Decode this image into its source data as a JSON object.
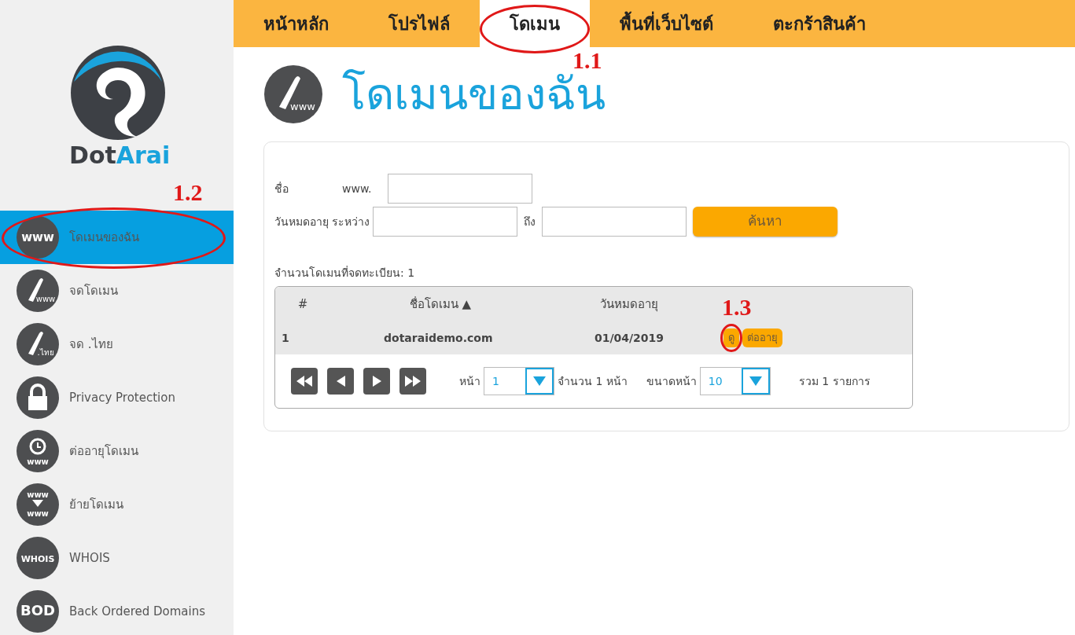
{
  "nav": [
    {
      "label": "หน้าหลัก",
      "selected": false
    },
    {
      "label": "โปรไฟล์",
      "selected": false
    },
    {
      "label": "โดเมน",
      "selected": true,
      "callout": "1.1"
    },
    {
      "label": "พื้นที่เว็บไซต์",
      "selected": false
    },
    {
      "label": "ตะกร้าสินค้า",
      "selected": false
    }
  ],
  "logo": {
    "parts": [
      "Dot",
      "Arai"
    ]
  },
  "sidebar": {
    "items": [
      {
        "label": "โดเมนของฉัน",
        "kind": "text",
        "icon_texts": [
          "www"
        ],
        "selected": true,
        "callout": "1.2"
      },
      {
        "label": "จดโดเมน",
        "kind": "pen",
        "icon_texts": [
          "www"
        ],
        "selected": false
      },
      {
        "label": "จด .ไทย",
        "kind": "pen",
        "icon_texts": [
          ".ไทย"
        ],
        "selected": false
      },
      {
        "label": "Privacy Protection",
        "kind": "lock",
        "selected": false
      },
      {
        "label": "ต่ออายุโดเมน",
        "kind": "clock",
        "icon_texts": [
          "www"
        ],
        "selected": false
      },
      {
        "label": "ย้ายโดเมน",
        "kind": "transfer",
        "icon_texts": [
          "www",
          "www"
        ],
        "selected": false
      },
      {
        "label": "WHOIS",
        "kind": "text",
        "icon_texts": [
          "WHOIS"
        ],
        "selected": false
      },
      {
        "label": "Back Ordered Domains",
        "kind": "text",
        "icon_texts": [
          "BOD"
        ],
        "selected": false
      }
    ]
  },
  "page_title": {
    "text": "โดเมนของฉัน",
    "icon_text": "www"
  },
  "search": {
    "name_label": "ชื่อ",
    "prefix": "www.",
    "date_label": "วันหมดอายุ ระหว่าง",
    "to_label": "ถึง",
    "button": "ค้นหา"
  },
  "count_text": "จำนวนโดเมนที่จดทะเบียน: 1",
  "table": {
    "columns": [
      "#",
      "ชื่อโดเมน ▲",
      "วันหมดอายุ"
    ],
    "rows": [
      {
        "cells": [
          "1",
          "dotaraidemo.com",
          "01/04/2019"
        ],
        "actions": [
          {
            "label": "ดู",
            "callout": "1.3"
          },
          {
            "label": "ต่ออายุ"
          }
        ]
      }
    ]
  },
  "pager": {
    "page_label": "หน้า",
    "page": "1",
    "pages_text": "จำนวน 1 หน้า",
    "size_label": "ขนาดหน้า",
    "size": "10",
    "total_text": "รวม 1 รายการ"
  }
}
